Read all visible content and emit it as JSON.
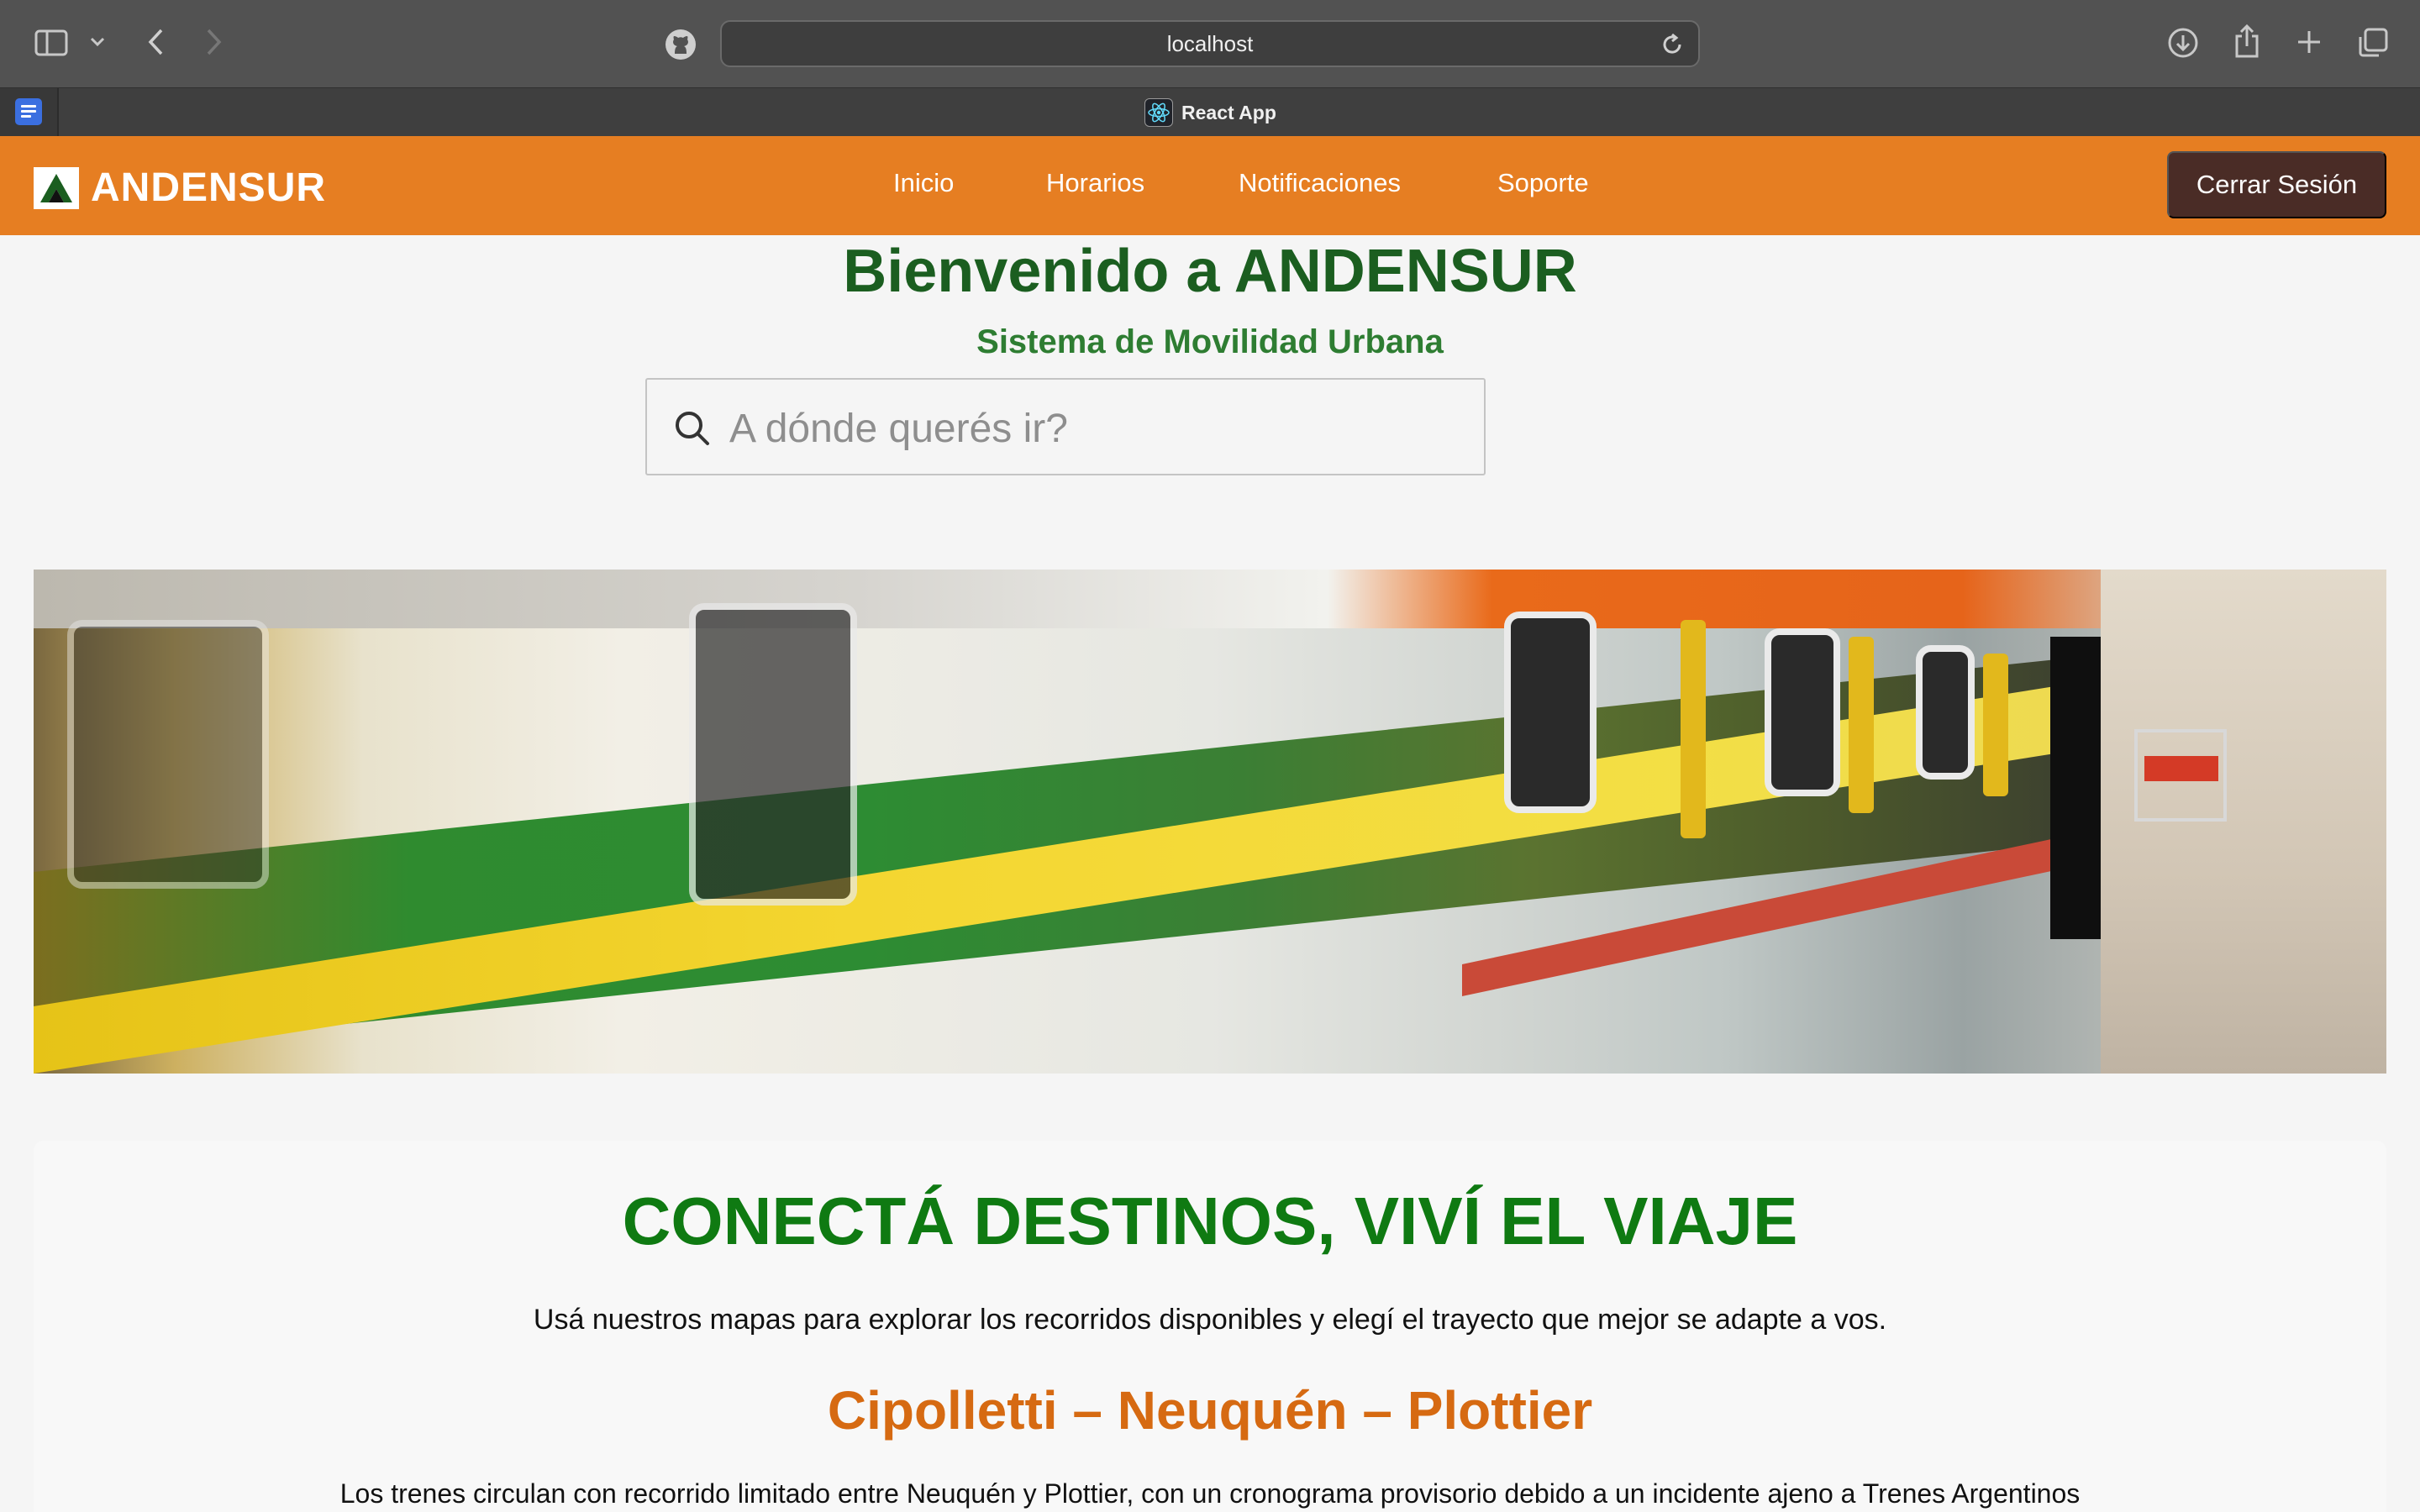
{
  "browser": {
    "url": "localhost",
    "tab_title": "React App",
    "icons": [
      "sidebar-icon",
      "chevron-down-icon",
      "back-icon",
      "forward-icon",
      "github-icon",
      "reload-icon",
      "download-icon",
      "share-icon",
      "new-tab-icon",
      "tabs-overview-icon",
      "docs-icon",
      "react-icon"
    ]
  },
  "nav": {
    "brand": "ANDENSUR",
    "links": [
      "Inicio",
      "Horarios",
      "Notificaciones",
      "Soporte"
    ],
    "logout_label": "Cerrar Sesión",
    "color": "#e67e22",
    "logout_color": "#4a2c26"
  },
  "hero": {
    "title": "Bienvenido a ANDENSUR",
    "subtitle": "Sistema de Movilidad Urbana",
    "search_placeholder": "A dónde querés ir?"
  },
  "banner": {
    "image": "train-in-motion-photo"
  },
  "section": {
    "title": "CONECTÁ DESTINOS, VIVÍ EL VIAJE",
    "text": "Usá nuestros mapas para explorar los recorridos disponibles y elegí el trayecto que mejor se adapte a vos.",
    "route_title": "Cipolletti – Neuquén – Plottier",
    "route_text": "Los trenes circulan con recorrido limitado entre Neuquén y Plottier, con un cronograma provisorio debido a un incidente ajeno a Trenes Argentinos",
    "title_color": "#0f7a12",
    "route_color": "#d66a12"
  }
}
